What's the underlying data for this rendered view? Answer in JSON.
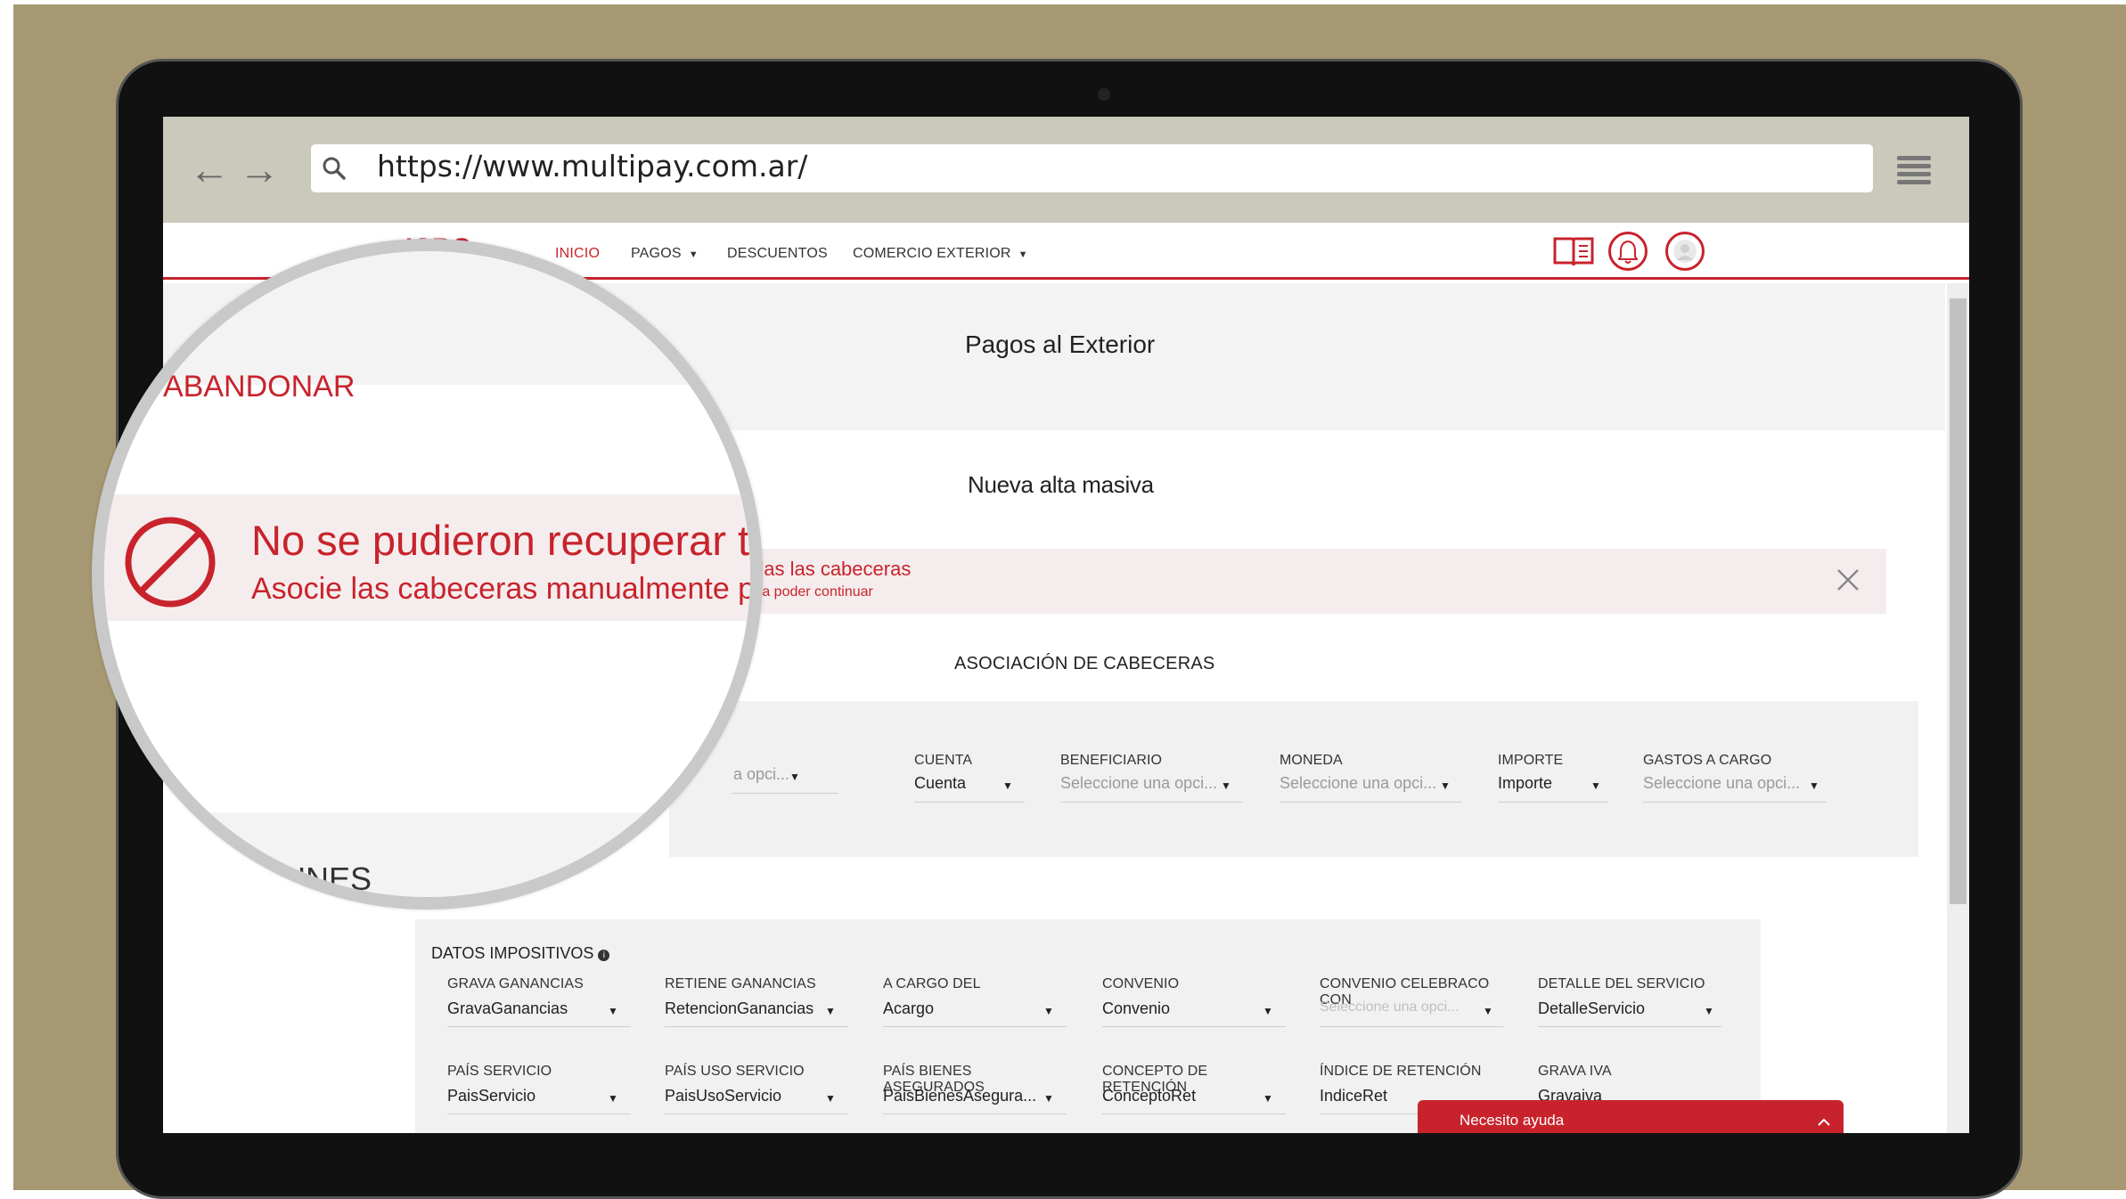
{
  "browser": {
    "url": "https://www.multipay.com.ar/",
    "back_label": "←",
    "forward_label": "→"
  },
  "site": {
    "logo_text": "ICBC",
    "nav": [
      {
        "label": "INICIO",
        "active": true
      },
      {
        "label": "PAGOS",
        "dropdown": true
      },
      {
        "label": "DESCUENTOS"
      },
      {
        "label": "COMERCIO EXTERIOR",
        "dropdown": true
      }
    ],
    "header_icons": [
      "book-icon",
      "bell-icon",
      "user-icon"
    ],
    "accent_color": "#c8232c"
  },
  "page": {
    "title": "Pagos al Exterior",
    "abandon_label": "ABANDONAR",
    "subtitle": "Nueva alta masiva",
    "alert": {
      "title_full": "No se pudieron recuperar todas las cabeceras",
      "title_visible": "das las cabeceras",
      "message_visible": "ra poder continuar",
      "close_icon": "close-icon"
    },
    "assoc_heading": "ASOCIACIÓN DE CABECERAS",
    "assoc_fields": [
      {
        "label": "",
        "value": "a opci...",
        "placeholder": true
      },
      {
        "label": "CUENTA",
        "value": "Cuenta",
        "placeholder": false
      },
      {
        "label": "BENEFICIARIO",
        "value": "Seleccione una opci...",
        "placeholder": true
      },
      {
        "label": "MONEDA",
        "value": "Seleccione una opci...",
        "placeholder": true
      },
      {
        "label": "IMPORTE",
        "value": "Importe",
        "placeholder": false
      },
      {
        "label": "GASTOS A CARGO",
        "value": "Seleccione una opci...",
        "placeholder": true
      }
    ],
    "common_heading": "MUNES",
    "tax": {
      "heading": "DATOS IMPOSITIVOS",
      "info_icon": "info-icon",
      "row1": [
        {
          "label": "GRAVA GANANCIAS",
          "value": "GravaGanancias",
          "placeholder": false
        },
        {
          "label": "RETIENE GANANCIAS",
          "value": "RetencionGanancias",
          "placeholder": false
        },
        {
          "label": "A CARGO DEL",
          "value": "Acargo",
          "placeholder": false
        },
        {
          "label": "CONVENIO",
          "value": "Convenio",
          "placeholder": false
        },
        {
          "label": "CONVENIO CELEBRACO CON",
          "value": "Seleccione una opci...",
          "placeholder": true
        },
        {
          "label": "DETALLE DEL SERVICIO",
          "value": "DetalleServicio",
          "placeholder": false
        }
      ],
      "row2": [
        {
          "label": "PAÍS SERVICIO",
          "value": "PaisServicio",
          "placeholder": false
        },
        {
          "label": "PAÍS USO SERVICIO",
          "value": "PaisUsoServicio",
          "placeholder": false
        },
        {
          "label": "PAÍS BIENES ASEGURADOS",
          "value": "PaisBienesAsegura...",
          "placeholder": false
        },
        {
          "label": "CONCEPTO DE RETENCIÓN",
          "value": "ConceptoRet",
          "placeholder": false
        },
        {
          "label": "ÍNDICE DE RETENCIÓN",
          "value": "IndiceRet",
          "placeholder": false
        },
        {
          "label": "GRAVA IVA",
          "value": "Gravaiva",
          "placeholder": false
        }
      ]
    },
    "help_label": "Necesito ayuda"
  },
  "magnifier": {
    "abandon_label": "ABANDONAR",
    "alert_title": "No se pudieron recuperar t",
    "alert_message": "Asocie las cabeceras manualmente p",
    "common_heading": "MUNES"
  }
}
